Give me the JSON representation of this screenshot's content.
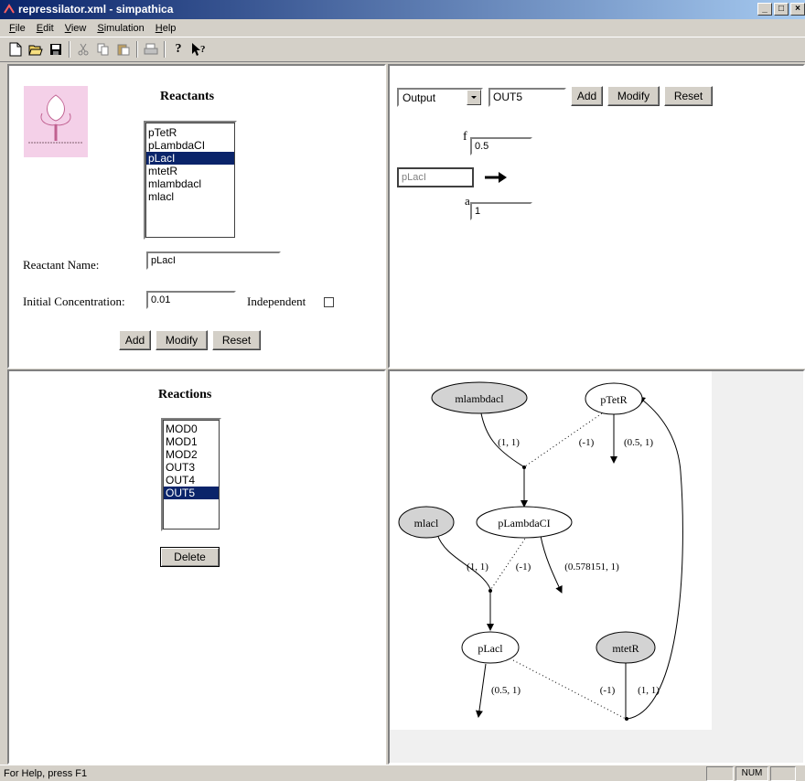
{
  "window": {
    "title": "repressilator.xml - simpathica"
  },
  "menu": [
    {
      "label": "File",
      "mn": "F",
      "rest": "ile"
    },
    {
      "label": "Edit",
      "mn": "E",
      "rest": "dit"
    },
    {
      "label": "View",
      "mn": "V",
      "rest": "iew"
    },
    {
      "label": "Simulation",
      "mn": "S",
      "rest": "imulation"
    },
    {
      "label": "Help",
      "mn": "H",
      "rest": "elp"
    }
  ],
  "toolbar_icons": [
    "new-file-icon",
    "open-folder-icon",
    "save-icon",
    "cut-icon",
    "copy-icon",
    "paste-icon",
    "print-icon",
    "about-icon",
    "context-help-icon"
  ],
  "reactants": {
    "heading": "Reactants",
    "list": [
      "pTetR",
      "pLambdaCI",
      "pLacI",
      "mtetR",
      "mlambdacl",
      "mlacl"
    ],
    "selected_index": 2,
    "name_label": "Reactant Name:",
    "name_value": "pLacI",
    "conc_label": "Initial Concentration:",
    "conc_value": "0.01",
    "independent_label": "Independent",
    "buttons": {
      "add": "Add",
      "modify": "Modify",
      "reset": "Reset"
    }
  },
  "reaction_editor": {
    "type_select": "Output",
    "name_value": "OUT5",
    "buttons": {
      "add": "Add",
      "modify": "Modify",
      "reset": "Reset"
    },
    "f_label": "f",
    "f_value": "0.5",
    "reactant_value": "pLacI",
    "a_label": "a",
    "a_value": "1"
  },
  "reactions": {
    "heading": "Reactions",
    "list": [
      "MOD0",
      "MOD1",
      "MOD2",
      "OUT3",
      "OUT4",
      "OUT5"
    ],
    "selected_index": 5,
    "delete_label": "Delete"
  },
  "graph": {
    "nodes": {
      "mlambdacl": "mlambdacl",
      "ptetr": "pTetR",
      "mlacl": "mlacl",
      "plambdaci": "pLambdaCI",
      "placl": "pLacl",
      "mtetr": "mtetR"
    },
    "edge_labels": {
      "e1": "(1, 1)",
      "e2": "(-1)",
      "e3": "(0.5, 1)",
      "e4": "(1, 1)",
      "e5": "(-1)",
      "e6": "(0.578151, 1)",
      "e7": "(0.5, 1)",
      "e8": "(-1)",
      "e9": "(1, 1)"
    }
  },
  "status": {
    "text": "For Help, press F1",
    "num": "NUM"
  }
}
